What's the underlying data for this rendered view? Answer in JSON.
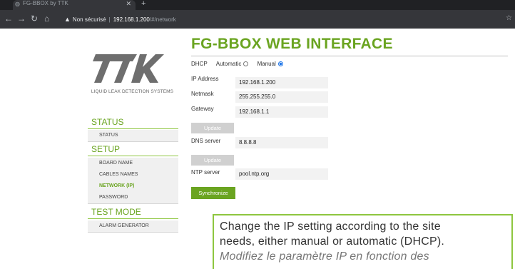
{
  "browser": {
    "tab_title": "FG-BBOX by TTK",
    "tab_close": "✕",
    "new_tab": "+",
    "insecure_label": "Non sécurisé",
    "url_host": "192.168.1.200",
    "url_path": "/#/network"
  },
  "sidebar": {
    "logo_text": "TTK",
    "tagline": "LIQUID LEAK DETECTION SYSTEMS",
    "status_heading": "STATUS",
    "status_items": [
      "STATUS"
    ],
    "setup_heading": "SETUP",
    "setup_items": [
      "BOARD NAME",
      "CABLES NAMES",
      "NETWORK (IP)",
      "PASSWORD"
    ],
    "test_heading": "TEST MODE",
    "test_items": [
      "ALARM GENERATOR"
    ]
  },
  "main": {
    "title": "FG-BBOX WEB INTERFACE",
    "dhcp_label": "DHCP",
    "automatic_label": "Automatic",
    "manual_label": "Manual",
    "selected_mode": "Manual",
    "ip_label": "IP Address",
    "ip_value": "192.168.1.200",
    "netmask_label": "Netmask",
    "netmask_value": "255.255.255.0",
    "gateway_label": "Gateway",
    "gateway_value": "192.168.1.1",
    "update_label": "Update",
    "dns_label": "DNS server",
    "dns_value": "8.8.8.8",
    "ntp_label": "NTP server",
    "ntp_value": "pool.ntp.org",
    "sync_label": "Synchronize"
  },
  "callout": {
    "en_line1": "Change the IP setting according to the site",
    "en_line2": "needs, either manual or automatic (DHCP).",
    "fr_line1": "Modifiez le paramètre IP en fonction des"
  },
  "colors": {
    "accent_green": "#6aa420",
    "chrome_dark": "#35363a"
  }
}
